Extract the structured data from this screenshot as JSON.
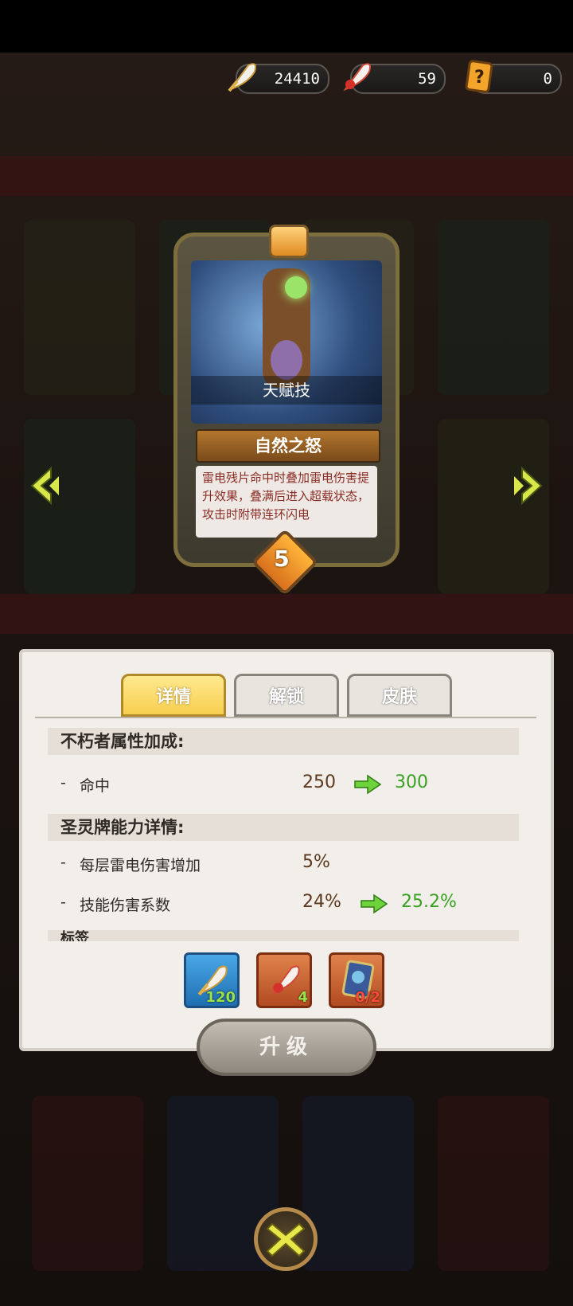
{
  "currency": [
    {
      "name": "feather-gold",
      "value": "24410"
    },
    {
      "name": "feather-red",
      "value": "59"
    },
    {
      "name": "mystery-card",
      "value": "0"
    }
  ],
  "card": {
    "type_label": "天赋技",
    "name": "自然之怒",
    "description": "雷电残片命中时叠加雷电伤害提升效果，叠满后进入超载状态，攻击时附带连环闪电",
    "level": "5"
  },
  "tabs": [
    {
      "label": "详情",
      "active": true
    },
    {
      "label": "解锁",
      "active": false
    },
    {
      "label": "皮肤",
      "active": false
    }
  ],
  "sections": {
    "attr_title": "不朽者属性加成:",
    "ability_title": "圣灵牌能力详情:",
    "next_title": "标签"
  },
  "attr_rows": [
    {
      "label": "命中",
      "from": "250",
      "to": "300"
    }
  ],
  "ability_rows": [
    {
      "label": "每层雷电伤害增加",
      "from": "5%",
      "to": ""
    },
    {
      "label": "技能伤害系数",
      "from": "24%",
      "to": "25.2%"
    }
  ],
  "costs": [
    {
      "icon": "feather-gold-icon",
      "amount": "120",
      "color": "#9be14a"
    },
    {
      "icon": "feather-red-icon",
      "amount": "4",
      "color": "#9be14a"
    },
    {
      "icon": "hero-card-icon",
      "amount": "0/2",
      "color": "#ff4a3a"
    }
  ],
  "upgrade_label": "升级",
  "dash": "-"
}
